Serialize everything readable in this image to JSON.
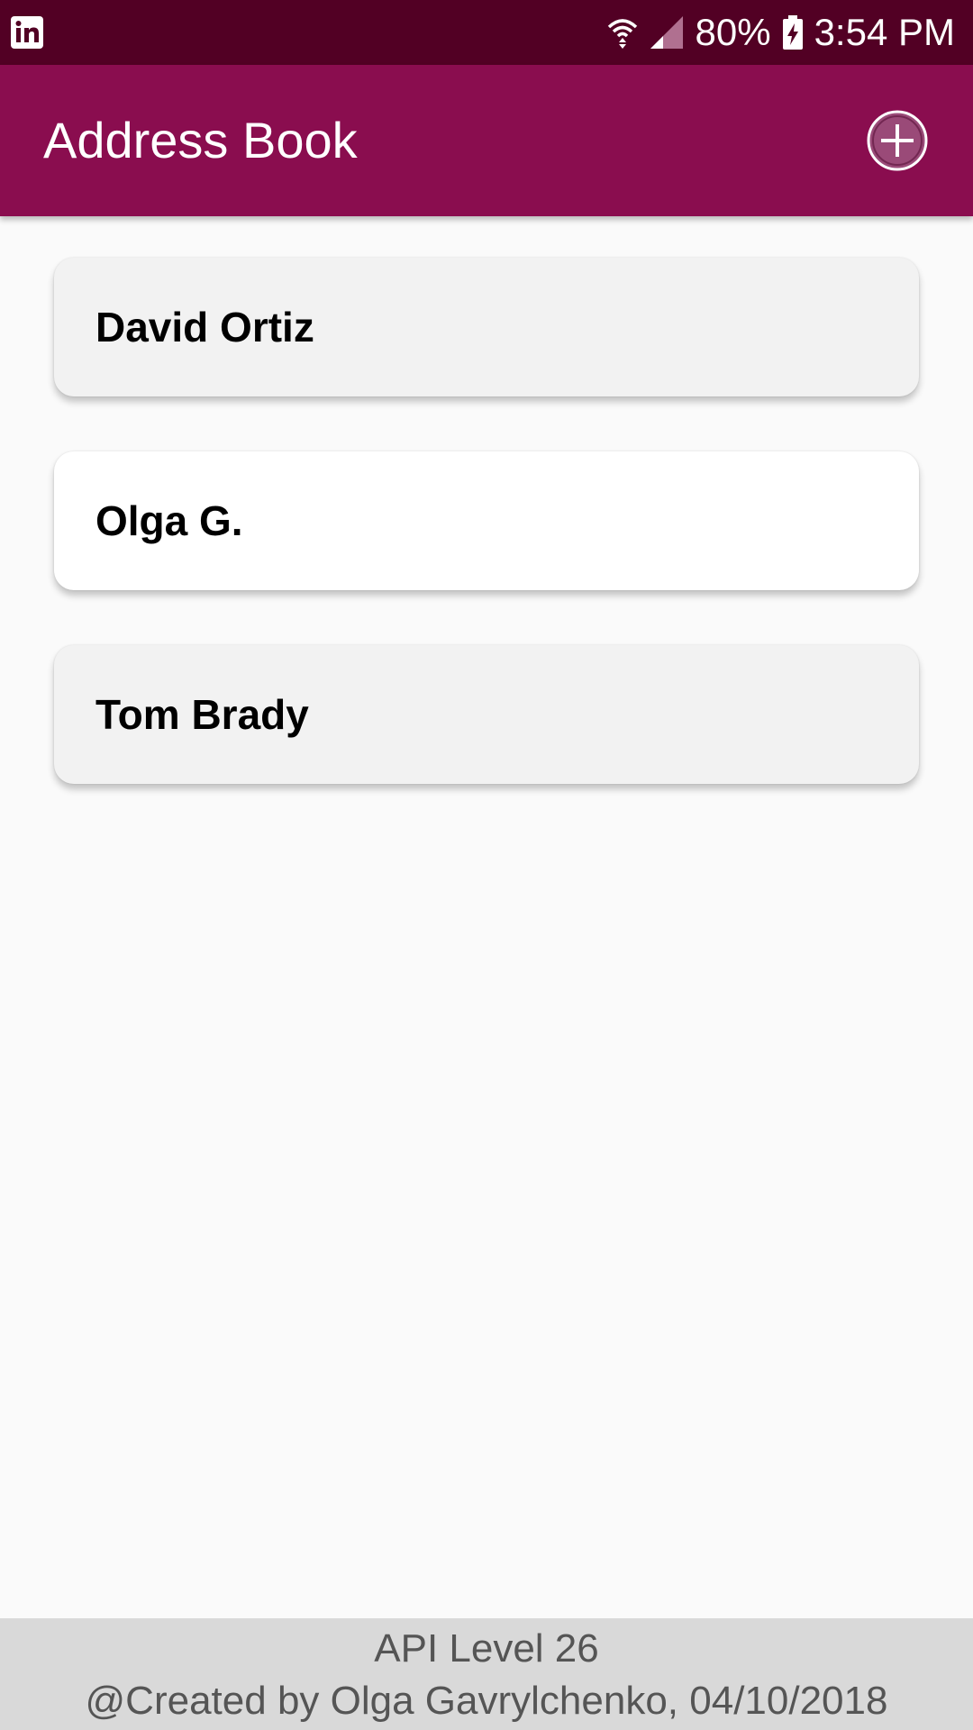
{
  "status_bar": {
    "battery": "80%",
    "time": "3:54 PM",
    "icons": [
      "linkedin-icon",
      "wifi-icon",
      "signal-icon",
      "battery-charging-icon"
    ]
  },
  "app_bar": {
    "title": "Address Book",
    "add_icon": "add-circle-icon"
  },
  "contacts": [
    {
      "name": "David Ortiz"
    },
    {
      "name": "Olga G."
    },
    {
      "name": "Tom Brady"
    }
  ],
  "footer": {
    "line1": "API Level 26",
    "line2": "@Created by Olga Gavrylchenko, 04/10/2018"
  },
  "colors": {
    "status_bar": "#520024",
    "app_bar": "#8a0d4f",
    "background": "#fafafa",
    "footer": "#d9d9d9"
  }
}
